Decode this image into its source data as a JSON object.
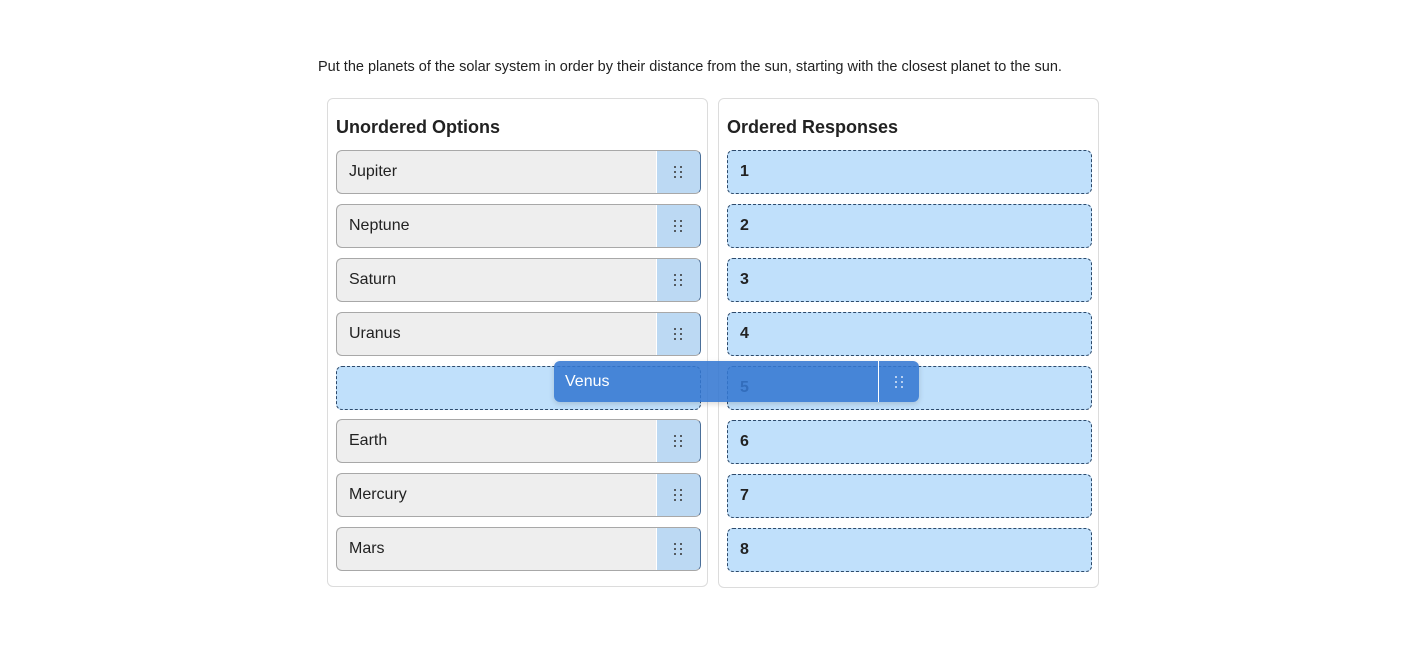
{
  "prompt": "Put the planets of the solar system in order by their distance from the sun, starting with the closest planet to the sun.",
  "unordered": {
    "title": "Unordered Options",
    "items": [
      {
        "label": "Jupiter"
      },
      {
        "label": "Neptune"
      },
      {
        "label": "Saturn"
      },
      {
        "label": "Uranus"
      },
      {
        "label": ""
      },
      {
        "label": "Earth"
      },
      {
        "label": "Mercury"
      },
      {
        "label": "Mars"
      }
    ],
    "handle_icon": "drag-handle-icon"
  },
  "ordered": {
    "title": "Ordered Responses",
    "slots": [
      "1",
      "2",
      "3",
      "4",
      "5",
      "6",
      "7",
      "8"
    ]
  },
  "dragging": {
    "label": "Venus",
    "handle_icon": "drag-handle-icon"
  }
}
